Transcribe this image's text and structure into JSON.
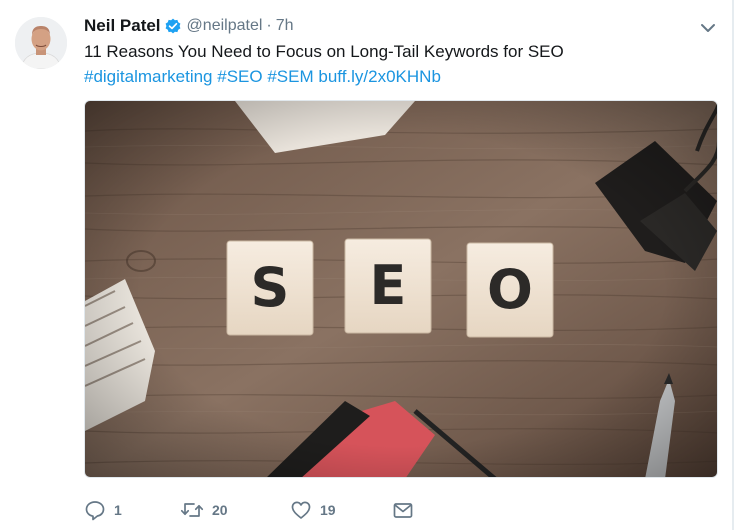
{
  "tweet": {
    "author_name": "Neil Patel",
    "handle": "@neilpatel",
    "separator": "·",
    "time": "7h",
    "text": "11 Reasons You Need to Focus on Long-Tail Keywords for SEO",
    "hashtags": [
      "#digitalmarketing",
      "#SEO",
      "#SEM"
    ],
    "link": "buff.ly/2x0KHNb",
    "media": {
      "tiles": [
        "S",
        "E",
        "O"
      ]
    },
    "actions": {
      "reply_count": "1",
      "retweet_count": "20",
      "like_count": "19"
    },
    "icons": {
      "verified": "verified-badge-icon",
      "caret": "chevron-down-icon",
      "reply": "reply-icon",
      "retweet": "retweet-icon",
      "like": "heart-icon",
      "dm": "envelope-icon"
    },
    "colors": {
      "link": "#1b95e0",
      "muted": "#657786",
      "verified": "#1da1f2",
      "text": "#14171a"
    }
  }
}
